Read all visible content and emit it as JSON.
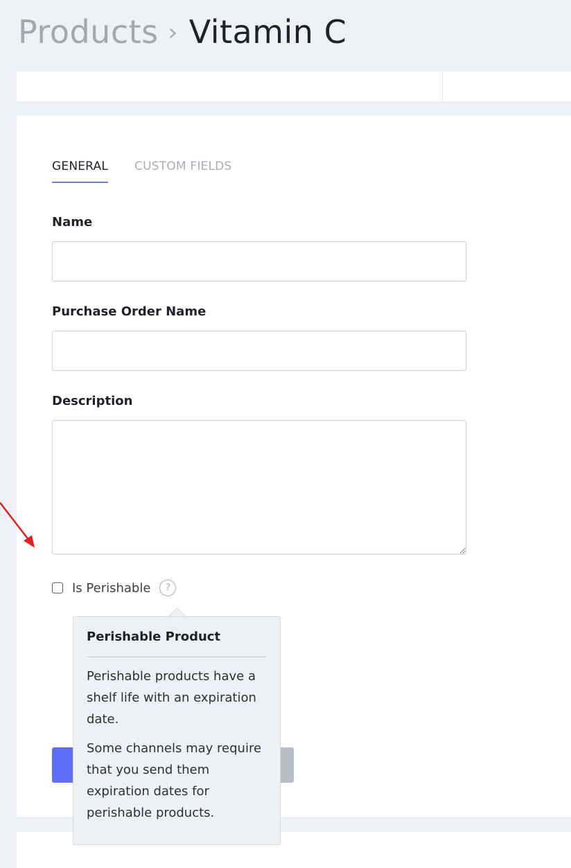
{
  "breadcrumb": {
    "parent": "Products",
    "separator": "›",
    "current": "Vitamin C"
  },
  "tabs": [
    {
      "label": "GENERAL",
      "active": true
    },
    {
      "label": "CUSTOM FIELDS",
      "active": false
    }
  ],
  "form": {
    "name_label": "Name",
    "name_value": "",
    "po_name_label": "Purchase Order Name",
    "po_name_value": "",
    "description_label": "Description",
    "description_value": "",
    "perishable_label": "Is Perishable",
    "perishable_checked": false,
    "help_glyph": "?"
  },
  "tooltip": {
    "title": "Perishable Product",
    "paragraph1": "Perishable products have a shelf life with an expiration date.",
    "paragraph2": "Some channels may require that you send them expiration dates for perishable products."
  },
  "colors": {
    "accent": "#5f6ff5",
    "annotation_arrow": "#e02020"
  }
}
